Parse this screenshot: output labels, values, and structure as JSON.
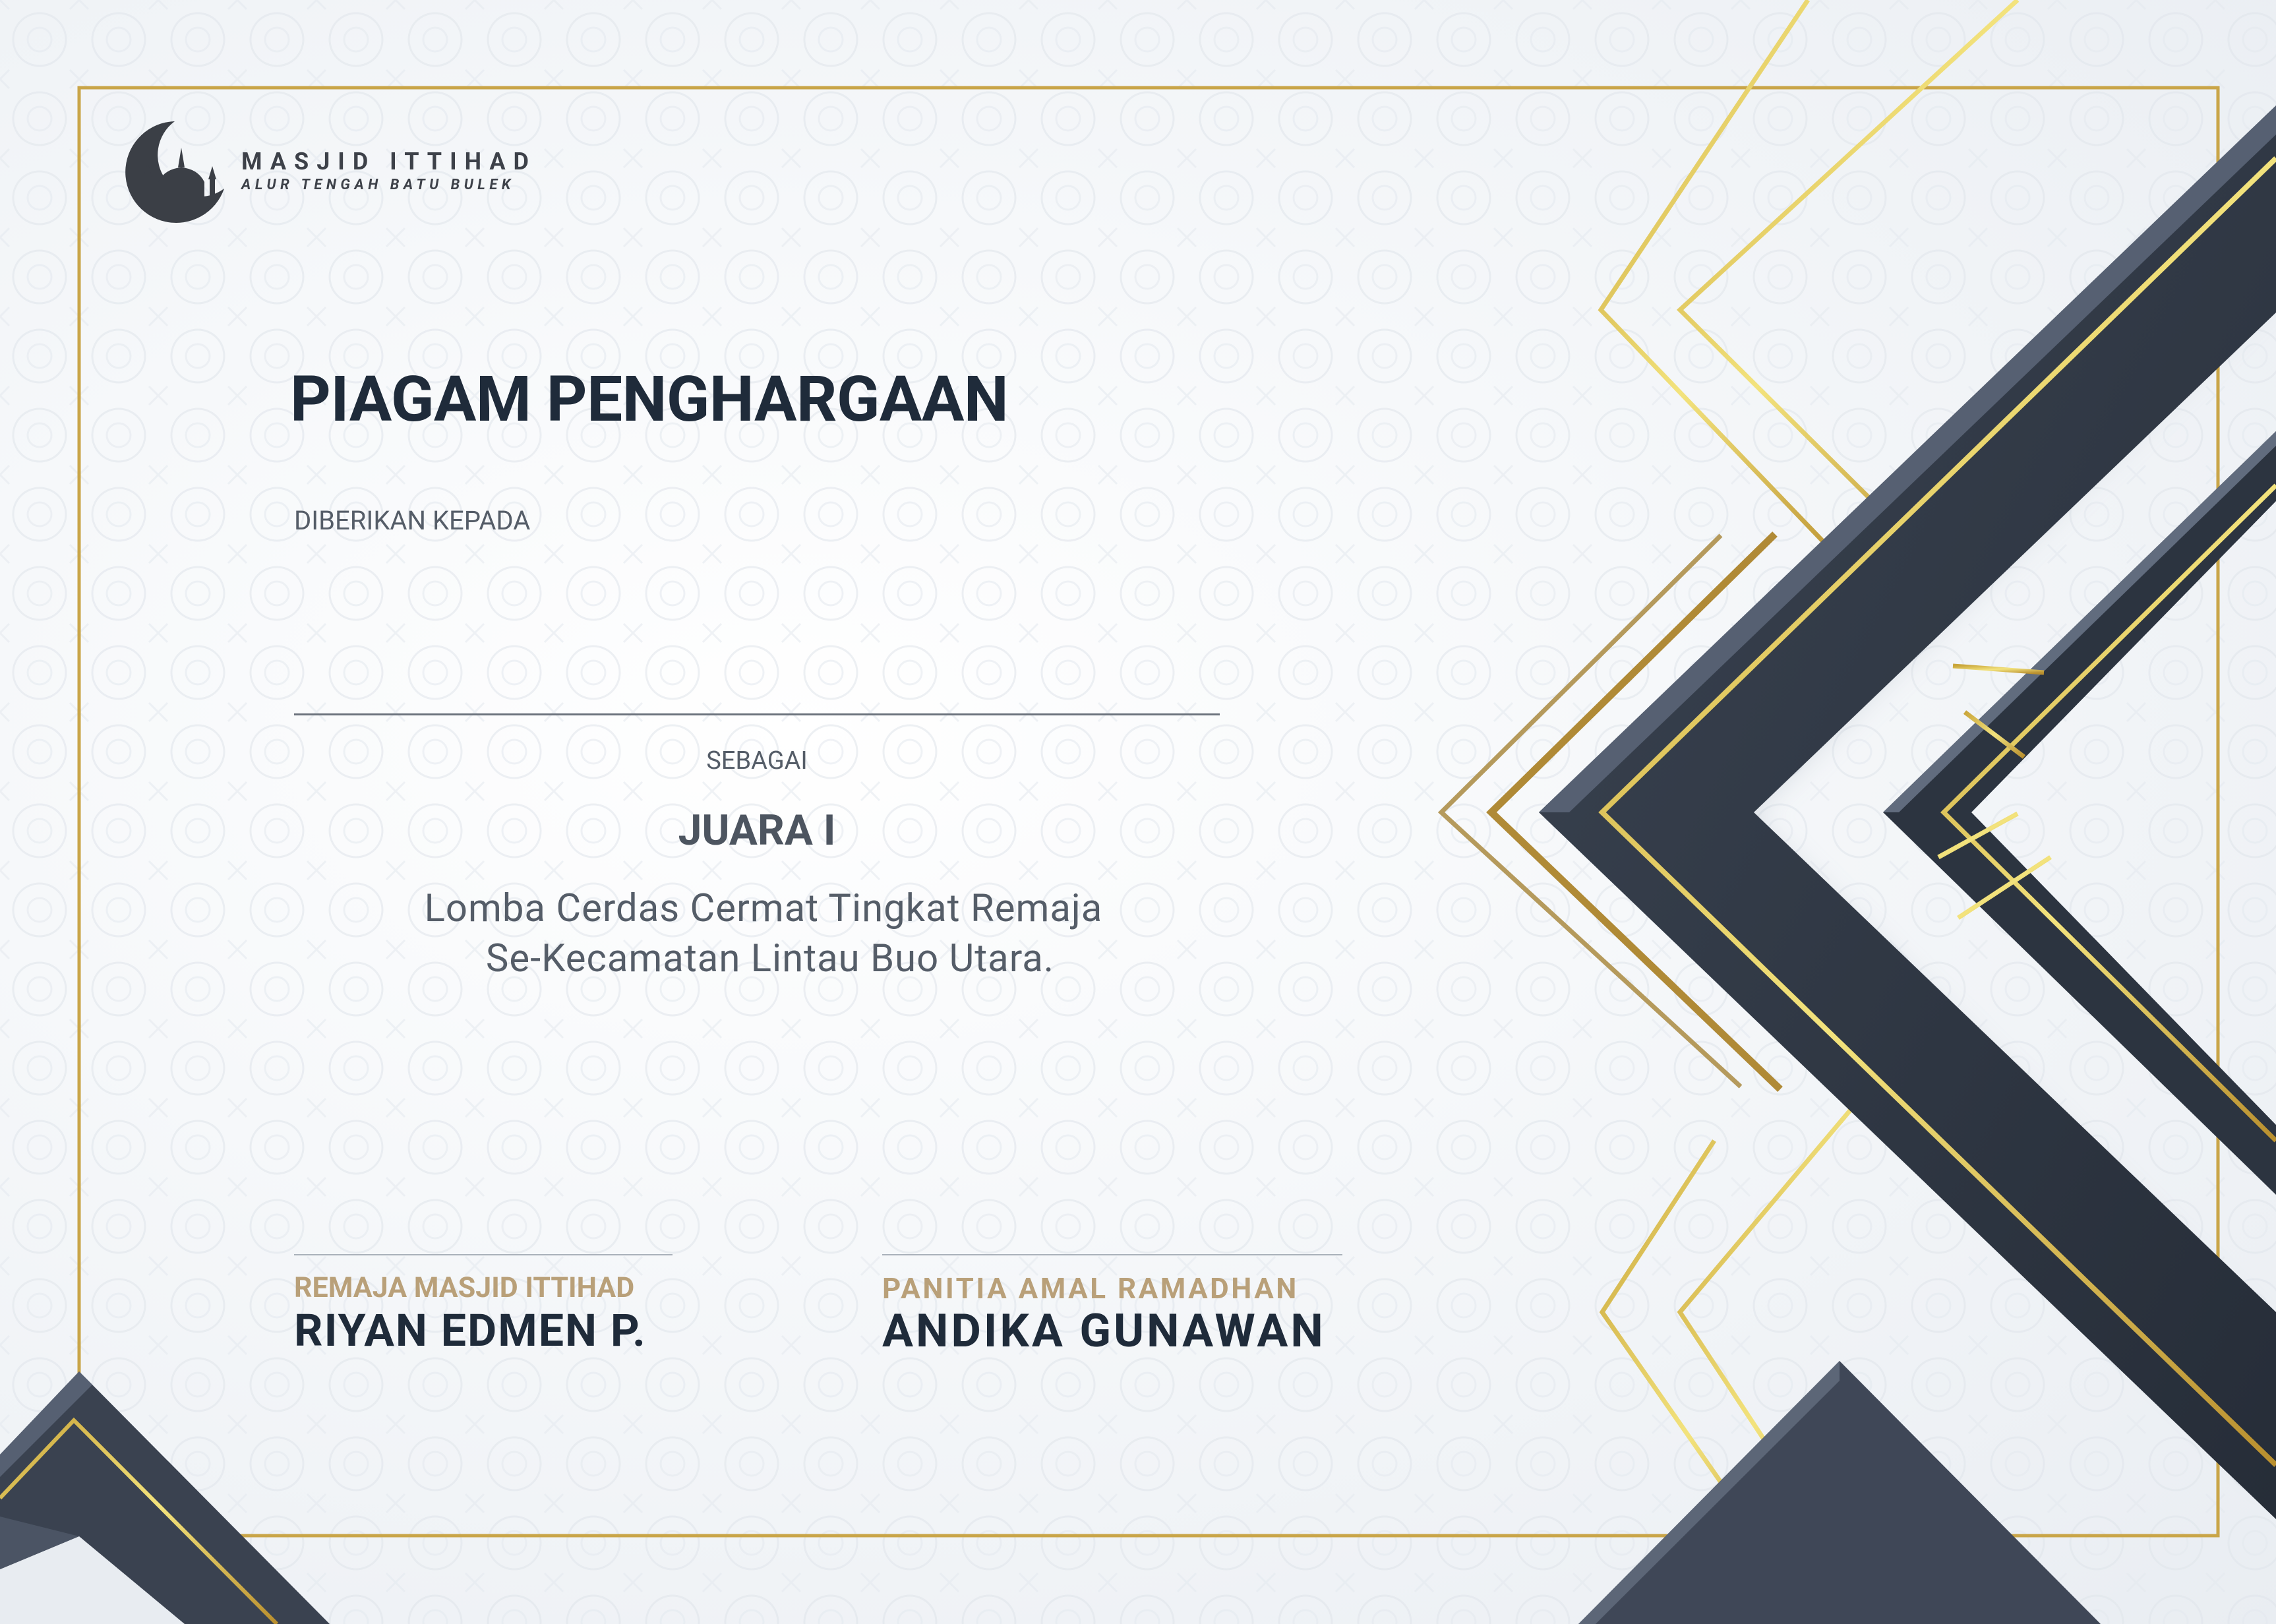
{
  "logo": {
    "name": "MASJID ITTIHAD",
    "subtitle": "ALUR TENGAH BATU BULEK"
  },
  "certificate": {
    "title": "PIAGAM PENGHARGAAN",
    "given_to_label": "DIBERIKAN KEPADA",
    "recipient_name": "",
    "as_label": "SEBAGAI",
    "rank": "JUARA I",
    "description_line1": "Lomba Cerdas Cermat Tingkat Remaja",
    "description_line2": "Se-Kecamatan Lintau Buo Utara."
  },
  "signatures": [
    {
      "role": "REMAJA MASJID ITTIHAD",
      "name": "RIYAN EDMEN P."
    },
    {
      "role": "PANITIA AMAL RAMADHAN",
      "name": "ANDIKA GUNAWAN"
    }
  ],
  "colors": {
    "navy": "#2f3744",
    "navy_dark": "#252c37",
    "gold": "#d6b545",
    "gold_light": "#f1e27c",
    "title_text": "#1f2b3a",
    "role_text": "#b9a079",
    "background": "#f3f5f8"
  }
}
